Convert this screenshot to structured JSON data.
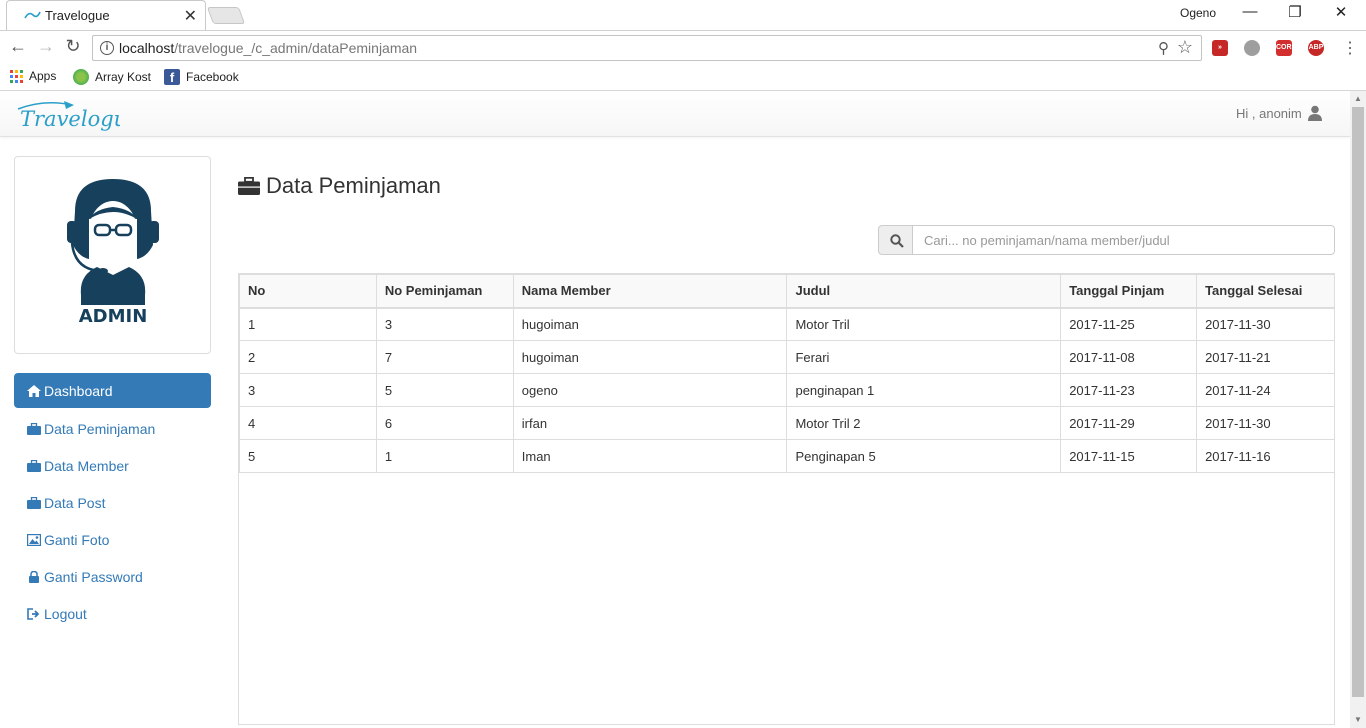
{
  "browser": {
    "tab_title": "Travelogue",
    "profile_name": "Ogeno",
    "url_host": "localhost",
    "url_path": "/travelogue_/c_admin/dataPeminjaman",
    "bookmarks": [
      {
        "label": "Apps"
      },
      {
        "label": "Array Kost"
      },
      {
        "label": "Facebook"
      }
    ],
    "extensions": [
      "cors-label",
      "abp-label"
    ],
    "ext_text": {
      "cors": "CORS",
      "abp": "ABP"
    }
  },
  "navbar": {
    "brand": "Travelogue",
    "greeting": "Hi , anonim"
  },
  "profile": {
    "role_label": "ADMIN"
  },
  "sidebar": {
    "items": [
      {
        "label": "Dashboard",
        "icon": "home-icon"
      },
      {
        "label": "Data Peminjaman",
        "icon": "briefcase-icon"
      },
      {
        "label": "Data Member",
        "icon": "briefcase-icon"
      },
      {
        "label": "Data Post",
        "icon": "briefcase-icon"
      },
      {
        "label": "Ganti Foto",
        "icon": "picture-icon"
      },
      {
        "label": "Ganti Password",
        "icon": "lock-icon"
      },
      {
        "label": "Logout",
        "icon": "logout-icon"
      }
    ]
  },
  "main": {
    "title": "Data Peminjaman",
    "search_placeholder": "Cari... no peminjaman/nama member/judul",
    "table": {
      "headers": [
        "No",
        "No Peminjaman",
        "Nama Member",
        "Judul",
        "Tanggal Pinjam",
        "Tanggal Selesai"
      ],
      "rows": [
        [
          "1",
          "3",
          "hugoiman",
          "Motor Tril",
          "2017-11-25",
          "2017-11-30"
        ],
        [
          "2",
          "7",
          "hugoiman",
          "Ferari",
          "2017-11-08",
          "2017-11-21"
        ],
        [
          "3",
          "5",
          "ogeno",
          "penginapan 1",
          "2017-11-23",
          "2017-11-24"
        ],
        [
          "4",
          "6",
          "irfan",
          "Motor Tril 2",
          "2017-11-29",
          "2017-11-30"
        ],
        [
          "5",
          "1",
          "Iman",
          "Penginapan 5",
          "2017-11-15",
          "2017-11-16"
        ]
      ]
    }
  },
  "colors": {
    "accent": "#337ab7",
    "brand": "#2a9fc9",
    "avatar": "#16405c"
  }
}
